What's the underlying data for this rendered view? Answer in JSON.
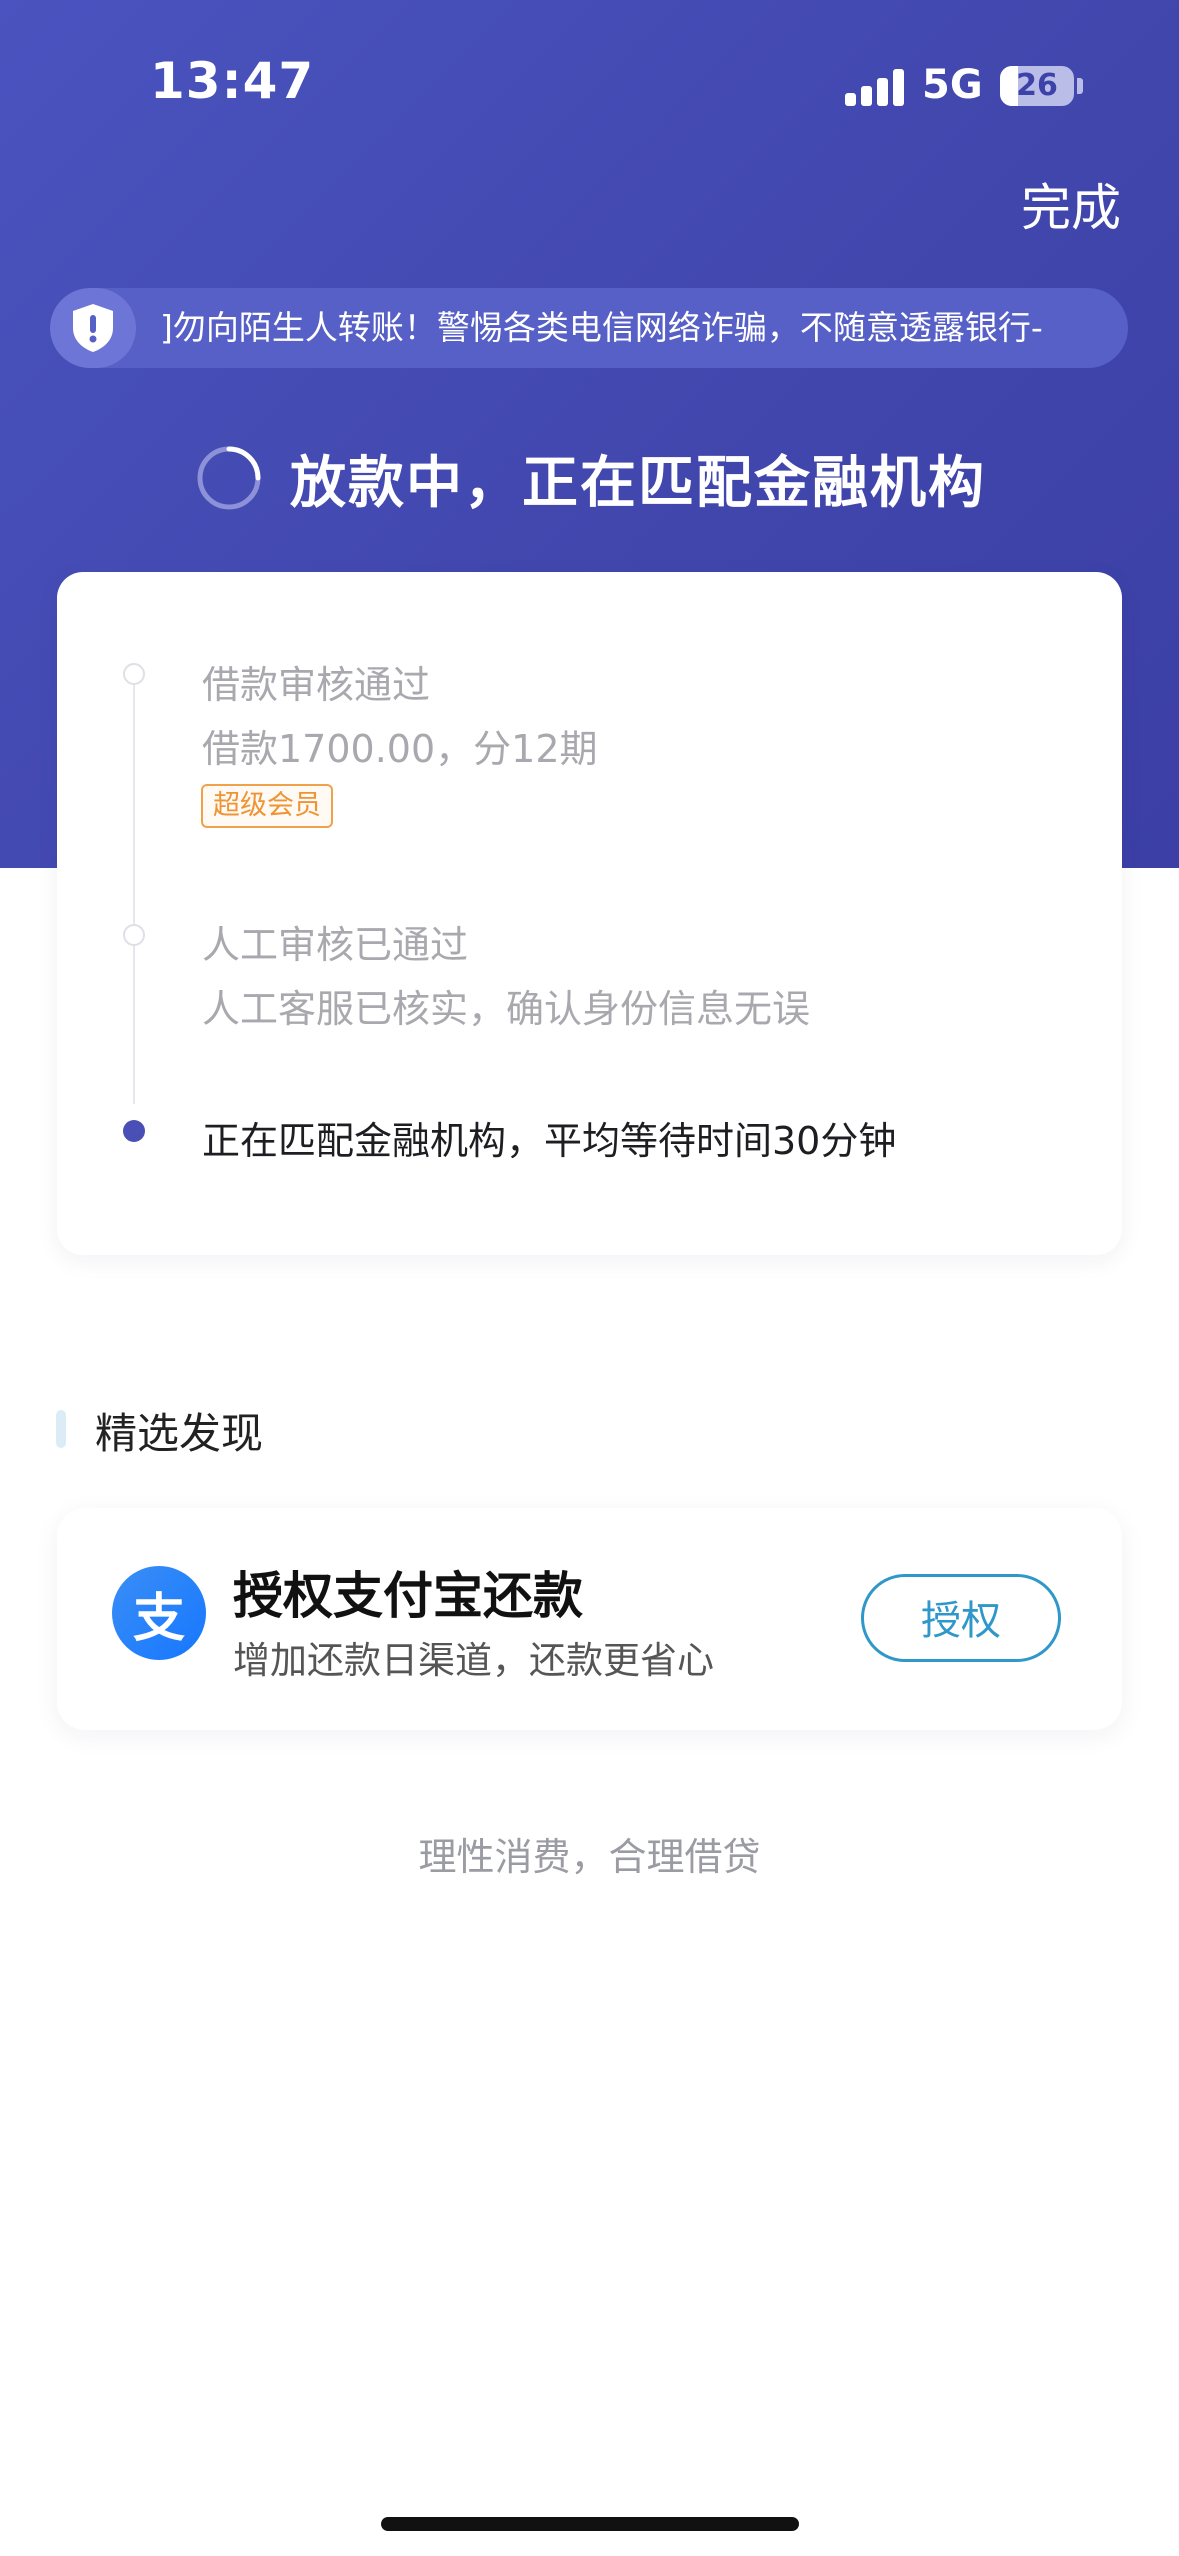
{
  "status_bar": {
    "time": "13:47",
    "network": "5G",
    "battery": "26"
  },
  "header": {
    "done_label": "完成"
  },
  "notice": {
    "text": "]勿向陌生人转账！警惕各类电信网络诈骗，不随意透露银行-"
  },
  "status": {
    "heading": "放款中，正在匹配金融机构"
  },
  "timeline": {
    "steps": [
      {
        "title": "借款审核通过",
        "desc": "借款1700.00，分12期",
        "badge": "超级会员"
      },
      {
        "title": "人工审核已通过",
        "desc": "人工客服已核实，确认身份信息无误"
      },
      {
        "title": "正在匹配金融机构，平均等待时间30分钟"
      }
    ]
  },
  "discover": {
    "section_title": "精选发现",
    "card": {
      "logo_char": "支",
      "title": "授权支付宝还款",
      "subtitle": "增加还款日渠道，还款更省心",
      "button": "授权"
    }
  },
  "footer": {
    "slogan": "理性消费，合理借贷"
  },
  "colors": {
    "hero": "#4147ad",
    "accent": "#4a4fb5",
    "badge": "#ee9434",
    "authorize": "#2f97c9"
  },
  "icons": [
    "shield-icon",
    "spinner-icon",
    "alipay-icon",
    "signal-icon",
    "battery-icon"
  ]
}
